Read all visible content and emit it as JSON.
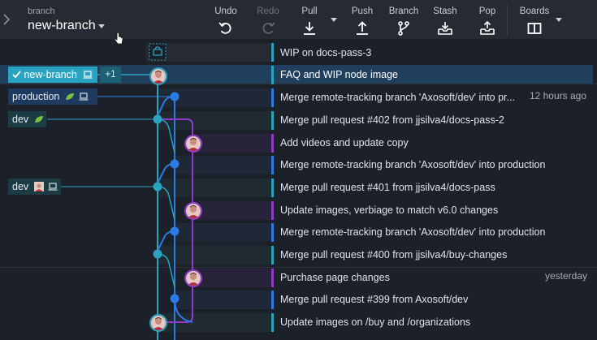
{
  "toolbar": {
    "branch_caption": "branch",
    "branch_name": "new-branch",
    "buttons": [
      {
        "label": "Undo",
        "icon": "undo-icon",
        "enabled": true
      },
      {
        "label": "Redo",
        "icon": "redo-icon",
        "enabled": false
      },
      {
        "label": "Pull",
        "icon": "pull-icon",
        "enabled": true
      },
      {
        "label": "Push",
        "icon": "push-icon",
        "enabled": true
      },
      {
        "label": "Branch",
        "icon": "branch-icon",
        "enabled": true
      },
      {
        "label": "Stash",
        "icon": "stash-icon",
        "enabled": true
      },
      {
        "label": "Pop",
        "icon": "pop-icon",
        "enabled": true
      },
      {
        "label": "Boards",
        "icon": "boards-icon",
        "enabled": true
      }
    ]
  },
  "refs": {
    "new_branch": "new-branch",
    "new_branch_extra": "+1",
    "production": "production",
    "dev_remote": "dev",
    "dev_local": "dev"
  },
  "commits": [
    {
      "message": "WIP on docs-pass-3",
      "time": ""
    },
    {
      "message": "FAQ and WIP node image",
      "time": ""
    },
    {
      "message": "Merge remote-tracking branch 'Axosoft/dev' into pr...",
      "time": "12 hours ago"
    },
    {
      "message": "Merge pull request #402 from jjsilva4/docs-pass-2",
      "time": ""
    },
    {
      "message": "Add videos and update copy",
      "time": ""
    },
    {
      "message": "Merge remote-tracking branch 'Axosoft/dev' into production",
      "time": ""
    },
    {
      "message": "Merge pull request #401 from jjsilva4/docs-pass",
      "time": ""
    },
    {
      "message": "Update images, verbiage to match v6.0 changes",
      "time": ""
    },
    {
      "message": "Merge remote-tracking branch 'Axosoft/dev' into production",
      "time": ""
    },
    {
      "message": "Merge pull request #400 from jjsilva4/buy-changes",
      "time": ""
    },
    {
      "message": "Purchase page changes",
      "time": "yesterday"
    },
    {
      "message": "Merge pull request #399 from Axosoft/dev",
      "time": ""
    },
    {
      "message": "Update images on /buy and /organizations",
      "time": ""
    }
  ],
  "colors": {
    "cyan": "#2aa3c0",
    "blue": "#2c7be5",
    "purple": "#8d3bc8",
    "selected_row": "#1f3f5c"
  }
}
